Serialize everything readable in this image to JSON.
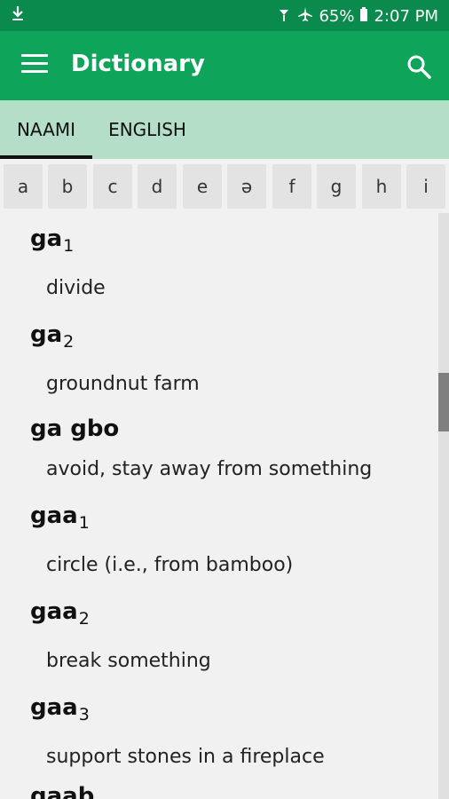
{
  "status": {
    "battery": "65%",
    "time": "2:07 PM"
  },
  "app": {
    "title": "Dictionary"
  },
  "tabs": [
    {
      "label": "NAAMI"
    },
    {
      "label": "ENGLISH"
    }
  ],
  "letters": [
    "a",
    "b",
    "c",
    "d",
    "e",
    "ə",
    "f",
    "g",
    "h",
    "i"
  ],
  "entries": [
    {
      "word": "ga",
      "index": "1",
      "definition": "divide"
    },
    {
      "word": "ga",
      "index": "2",
      "definition": "groundnut farm"
    },
    {
      "word": "ga gbo",
      "index": "",
      "definition": "avoid, stay away from something"
    },
    {
      "word": "gaa",
      "index": "1",
      "definition": "circle (i.e., from bamboo)"
    },
    {
      "word": "gaa",
      "index": "2",
      "definition": "break something"
    },
    {
      "word": "gaa",
      "index": "3",
      "definition": "support stones in a fireplace"
    },
    {
      "word": "gaab",
      "index": "",
      "definition": ""
    }
  ],
  "colors": {
    "status_bar": "#0a8a4c",
    "app_bar": "#0ea45a",
    "tabs_bg": "#b5dec9"
  }
}
